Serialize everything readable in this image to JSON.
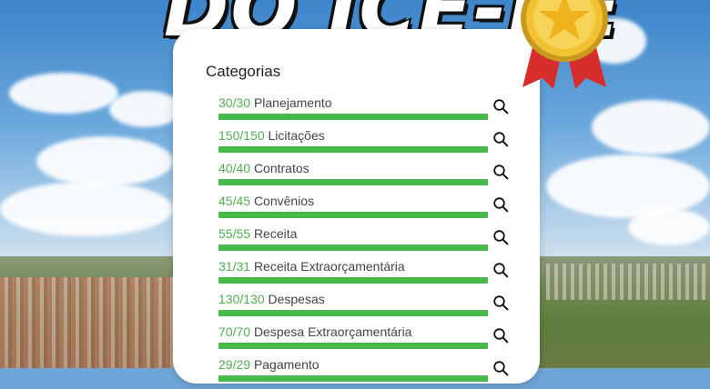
{
  "headline": {
    "text": "DO ICE-PE"
  },
  "panel": {
    "title": "Categorias"
  },
  "categories": [
    {
      "count": "30/30",
      "name": "Planejamento",
      "progress": 1.0
    },
    {
      "count": "150/150",
      "name": "Licitações",
      "progress": 1.0
    },
    {
      "count": "40/40",
      "name": "Contratos",
      "progress": 1.0
    },
    {
      "count": "45/45",
      "name": "Convênios",
      "progress": 1.0
    },
    {
      "count": "55/55",
      "name": "Receita",
      "progress": 1.0
    },
    {
      "count": "31/31",
      "name": "Receita Extraorçamentária",
      "progress": 1.0
    },
    {
      "count": "130/130",
      "name": "Despesas",
      "progress": 1.0
    },
    {
      "count": "70/70",
      "name": "Despesa Extraorçamentária",
      "progress": 1.0
    },
    {
      "count": "29/29",
      "name": "Pagamento",
      "progress": 1.0
    }
  ],
  "colors": {
    "accent_green": "#47b84a",
    "count_green": "#52b04f",
    "medal_gold": "#f2c233",
    "ribbon_red": "#d62d2d"
  },
  "icons": {
    "search": "search-icon",
    "medal": "medal-icon"
  }
}
